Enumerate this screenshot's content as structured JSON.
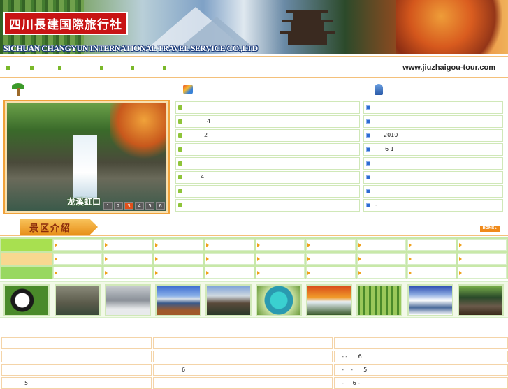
{
  "header": {
    "logo_cn": "四川長建国際旅行社",
    "logo_en": "SICHUAN CHANGYUN INTERNATIONAL TRAVEL SERVICE CO.,LTD"
  },
  "nav": {
    "site_url": "www.jiuzhaigou-tour.com",
    "bullet_count": 6
  },
  "sections": {
    "left_icon": "palm-tree-icon",
    "middle_icon": "flag-icon",
    "right_icon": "person-icon"
  },
  "featured": {
    "caption": "龙溪虹口",
    "pages": [
      "1",
      "2",
      "3",
      "4",
      "5",
      "6"
    ],
    "active_page": "3"
  },
  "news_list_a": [
    "",
    "4",
    "2",
    "",
    "",
    "4",
    "",
    ""
  ],
  "news_list_b": [
    "",
    "",
    "2010",
    "6 1",
    "",
    "",
    "",
    "-"
  ],
  "scenic": {
    "title": "景区介紹",
    "home_label": "HOME ▸",
    "row_colors": [
      "#a8e050",
      "#f8d890",
      "#98d860"
    ]
  },
  "thumbnails": [
    "panda",
    "buddha",
    "mountain-clouds",
    "lake-mountain",
    "village-bridge",
    "turquoise-pools",
    "autumn-waterfall",
    "bamboo-forest",
    "snow-valley",
    "ancient-town"
  ],
  "bottom_table": {
    "col1": [
      "",
      "",
      "",
      "5"
    ],
    "col2": [
      "",
      "",
      "6",
      ""
    ],
    "col3": [
      "",
      "- -      6",
      "-    -      5",
      "-     6 -"
    ]
  },
  "colors": {
    "accent_orange": "#f0a23a",
    "list_green": "#8fc43a",
    "list_blue": "#2e6bd2",
    "logo_red": "#c81414"
  }
}
